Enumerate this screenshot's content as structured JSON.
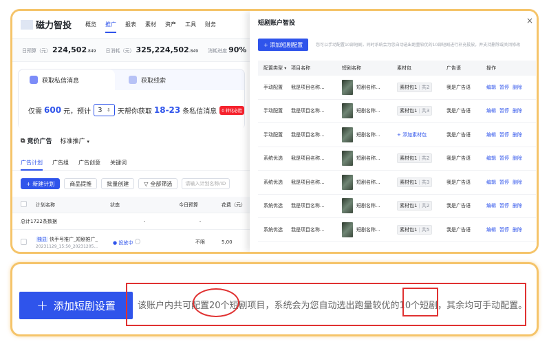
{
  "app": {
    "logo": "磁力智投",
    "nav": [
      "概览",
      "推广",
      "报表",
      "素材",
      "资产",
      "工具",
      "财务"
    ],
    "nav_active_index": 1
  },
  "stats": [
    {
      "label": "日预算（元）",
      "value": "224,502",
      "decimal": ".849"
    },
    {
      "label": "日消耗（元）",
      "value": "325,224,502",
      "decimal": ".849"
    },
    {
      "label": "消耗进度",
      "value": "90%",
      "decimal": ""
    }
  ],
  "promo": {
    "tab_active": "获取私信消息",
    "tab_inactive": "获取线索",
    "text_pay": "仅需",
    "amount": "600",
    "text_yuan": "元，预计",
    "select_value": "3",
    "text_days": "天帮你获取",
    "range": "18-23",
    "text_unit": "条私信消息",
    "badge": "0 转化必胜"
  },
  "section": {
    "title": "竞价广告",
    "subtitle": "标准推广"
  },
  "tabs": [
    "广告计划",
    "广告组",
    "广告创意",
    "关键词"
  ],
  "toolbar": {
    "new_plan": "+ 新建计划",
    "product": "商品提推",
    "batch": "批量创建",
    "filter": "全部筛选",
    "search_placeholder": "请输入计划名称/ID"
  },
  "table": {
    "headers": [
      "计划名称",
      "状态",
      "今日预算",
      "花费（元）"
    ],
    "total_label": "总计1722条数据",
    "total_dash1": "-",
    "total_dash2": "-",
    "row": {
      "tag": "独显",
      "name": "快手号推广_短剧推广_",
      "date": "20231129_15:50_20231205...",
      "status": "● 投放中",
      "budget": "不限",
      "spend": "5,00"
    }
  },
  "dialog": {
    "title": "短剧账户智投",
    "close": "×",
    "add_button": "+ 添加短剧配置",
    "hint": "您可以手动配置10部短剧，同时系统会为您自动选出跑量较优的10部短剧进行补充投放，并支持删除或关闭修改",
    "headers": [
      "配置类型",
      "项目名称",
      "短剧名称",
      "素材包",
      "广告语",
      "操作"
    ],
    "rows": [
      {
        "type": "手动配置",
        "project": "我是项目名称...",
        "drama": "短剧名称...",
        "pkg": "素材包1",
        "count": "共2",
        "slogan": "我是广告语",
        "add": ""
      },
      {
        "type": "手动配置",
        "project": "我是项目名称...",
        "drama": "短剧名称...",
        "pkg": "素材包1",
        "count": "共3",
        "slogan": "我是广告语",
        "add": ""
      },
      {
        "type": "手动配置",
        "project": "我是项目名称...",
        "drama": "短剧名称...",
        "pkg": "",
        "count": "",
        "slogan": "我是广告语",
        "add": "+ 添加素材包"
      },
      {
        "type": "系统优选",
        "project": "我是项目名称...",
        "drama": "短剧名称...",
        "pkg": "素材包1",
        "count": "共2",
        "slogan": "我是广告语",
        "add": ""
      },
      {
        "type": "系统优选",
        "project": "我是项目名称...",
        "drama": "短剧名称...",
        "pkg": "素材包1",
        "count": "共3",
        "slogan": "我是广告语",
        "add": ""
      },
      {
        "type": "系统优选",
        "project": "我是项目名称...",
        "drama": "短剧名称...",
        "pkg": "素材包1",
        "count": "共2",
        "slogan": "我是广告语",
        "add": ""
      },
      {
        "type": "系统优选",
        "project": "我是项目名称...",
        "drama": "短剧名称...",
        "pkg": "素材包1",
        "count": "共5",
        "slogan": "我是广告语",
        "add": ""
      }
    ],
    "ops": [
      "编辑",
      "暂停",
      "删除"
    ]
  },
  "bottom": {
    "big_button": "添加短剧设置",
    "note": "该账户内共可配置20个短剧项目，系统会为您自动选出跑量较优的10个短剧，其余均可手动配置。"
  },
  "colors": {
    "accent": "#2f54eb",
    "highlight": "#e03131",
    "frame": "#f5c46a"
  }
}
